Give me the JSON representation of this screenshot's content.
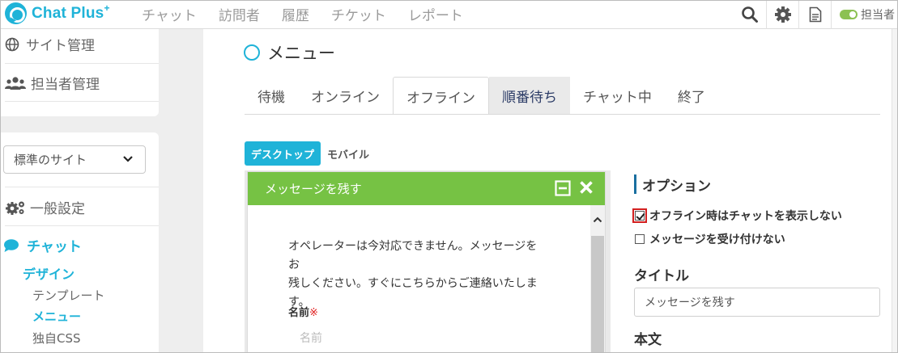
{
  "app": {
    "logo_text": "Chat Plus",
    "logo_super": "+"
  },
  "topnav": [
    "チャット",
    "訪問者",
    "履歴",
    "チケット",
    "レポート"
  ],
  "top_icons": {
    "search": "search-icon",
    "settings": "gear-icon",
    "document": "document-icon"
  },
  "operator": {
    "label": "担当者",
    "status_color": "#8cc152"
  },
  "sidebar": {
    "site_manage": "サイト管理",
    "operator_manage": "担当者管理",
    "site_select": "標準のサイト",
    "general_settings": "一般設定",
    "chat": "チャット",
    "design": "デザイン",
    "template": "テンプレート",
    "menu": "メニュー",
    "custom_css": "独自CSS"
  },
  "page": {
    "title": "メニュー"
  },
  "tabs": [
    "待機",
    "オンライン",
    "オフライン",
    "順番待ち",
    "チャット中",
    "終了"
  ],
  "active_tab": "オフライン",
  "device_tabs": {
    "desktop": "デスクトップ",
    "mobile": "モバイル"
  },
  "widget": {
    "header": "メッセージを残す",
    "message_line1": "オペレーターは今対応できません。メッセージをお",
    "message_line2": "残しください。すぐにこちらからご連絡いたしま",
    "message_line3": "す。",
    "name_label": "名前",
    "required_mark": "※",
    "name_placeholder": "名前",
    "header_color": "#76c244"
  },
  "options": {
    "heading": "オプション",
    "hide_chat_offline": "オフライン時はチャットを表示しない",
    "hide_chat_offline_checked": true,
    "no_messages": "メッセージを受け付けない",
    "no_messages_checked": false,
    "title_label": "タイトル",
    "title_value": "メッセージを残す",
    "body_label": "本文"
  },
  "colors": {
    "accent": "#1fb3d8",
    "brand_green": "#76c244",
    "checkbox_highlight": "#d21f1f"
  }
}
